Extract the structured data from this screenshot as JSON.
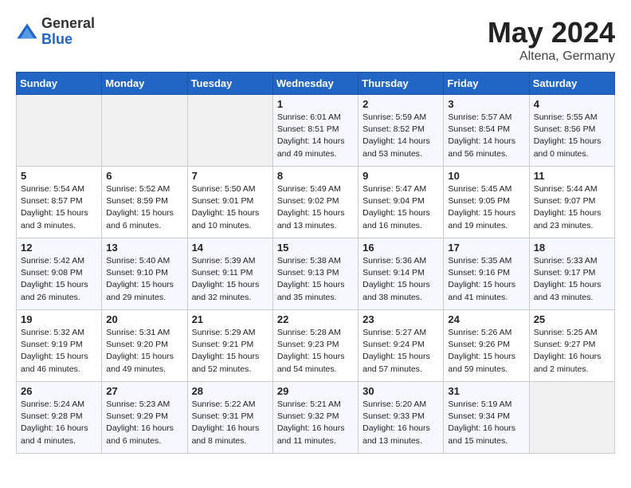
{
  "logo": {
    "general": "General",
    "blue": "Blue"
  },
  "title": {
    "month": "May 2024",
    "location": "Altena, Germany"
  },
  "weekdays": [
    "Sunday",
    "Monday",
    "Tuesday",
    "Wednesday",
    "Thursday",
    "Friday",
    "Saturday"
  ],
  "weeks": [
    [
      {
        "day": "",
        "content": ""
      },
      {
        "day": "",
        "content": ""
      },
      {
        "day": "",
        "content": ""
      },
      {
        "day": "1",
        "content": "Sunrise: 6:01 AM\nSunset: 8:51 PM\nDaylight: 14 hours\nand 49 minutes."
      },
      {
        "day": "2",
        "content": "Sunrise: 5:59 AM\nSunset: 8:52 PM\nDaylight: 14 hours\nand 53 minutes."
      },
      {
        "day": "3",
        "content": "Sunrise: 5:57 AM\nSunset: 8:54 PM\nDaylight: 14 hours\nand 56 minutes."
      },
      {
        "day": "4",
        "content": "Sunrise: 5:55 AM\nSunset: 8:56 PM\nDaylight: 15 hours\nand 0 minutes."
      }
    ],
    [
      {
        "day": "5",
        "content": "Sunrise: 5:54 AM\nSunset: 8:57 PM\nDaylight: 15 hours\nand 3 minutes."
      },
      {
        "day": "6",
        "content": "Sunrise: 5:52 AM\nSunset: 8:59 PM\nDaylight: 15 hours\nand 6 minutes."
      },
      {
        "day": "7",
        "content": "Sunrise: 5:50 AM\nSunset: 9:01 PM\nDaylight: 15 hours\nand 10 minutes."
      },
      {
        "day": "8",
        "content": "Sunrise: 5:49 AM\nSunset: 9:02 PM\nDaylight: 15 hours\nand 13 minutes."
      },
      {
        "day": "9",
        "content": "Sunrise: 5:47 AM\nSunset: 9:04 PM\nDaylight: 15 hours\nand 16 minutes."
      },
      {
        "day": "10",
        "content": "Sunrise: 5:45 AM\nSunset: 9:05 PM\nDaylight: 15 hours\nand 19 minutes."
      },
      {
        "day": "11",
        "content": "Sunrise: 5:44 AM\nSunset: 9:07 PM\nDaylight: 15 hours\nand 23 minutes."
      }
    ],
    [
      {
        "day": "12",
        "content": "Sunrise: 5:42 AM\nSunset: 9:08 PM\nDaylight: 15 hours\nand 26 minutes."
      },
      {
        "day": "13",
        "content": "Sunrise: 5:40 AM\nSunset: 9:10 PM\nDaylight: 15 hours\nand 29 minutes."
      },
      {
        "day": "14",
        "content": "Sunrise: 5:39 AM\nSunset: 9:11 PM\nDaylight: 15 hours\nand 32 minutes."
      },
      {
        "day": "15",
        "content": "Sunrise: 5:38 AM\nSunset: 9:13 PM\nDaylight: 15 hours\nand 35 minutes."
      },
      {
        "day": "16",
        "content": "Sunrise: 5:36 AM\nSunset: 9:14 PM\nDaylight: 15 hours\nand 38 minutes."
      },
      {
        "day": "17",
        "content": "Sunrise: 5:35 AM\nSunset: 9:16 PM\nDaylight: 15 hours\nand 41 minutes."
      },
      {
        "day": "18",
        "content": "Sunrise: 5:33 AM\nSunset: 9:17 PM\nDaylight: 15 hours\nand 43 minutes."
      }
    ],
    [
      {
        "day": "19",
        "content": "Sunrise: 5:32 AM\nSunset: 9:19 PM\nDaylight: 15 hours\nand 46 minutes."
      },
      {
        "day": "20",
        "content": "Sunrise: 5:31 AM\nSunset: 9:20 PM\nDaylight: 15 hours\nand 49 minutes."
      },
      {
        "day": "21",
        "content": "Sunrise: 5:29 AM\nSunset: 9:21 PM\nDaylight: 15 hours\nand 52 minutes."
      },
      {
        "day": "22",
        "content": "Sunrise: 5:28 AM\nSunset: 9:23 PM\nDaylight: 15 hours\nand 54 minutes."
      },
      {
        "day": "23",
        "content": "Sunrise: 5:27 AM\nSunset: 9:24 PM\nDaylight: 15 hours\nand 57 minutes."
      },
      {
        "day": "24",
        "content": "Sunrise: 5:26 AM\nSunset: 9:26 PM\nDaylight: 15 hours\nand 59 minutes."
      },
      {
        "day": "25",
        "content": "Sunrise: 5:25 AM\nSunset: 9:27 PM\nDaylight: 16 hours\nand 2 minutes."
      }
    ],
    [
      {
        "day": "26",
        "content": "Sunrise: 5:24 AM\nSunset: 9:28 PM\nDaylight: 16 hours\nand 4 minutes."
      },
      {
        "day": "27",
        "content": "Sunrise: 5:23 AM\nSunset: 9:29 PM\nDaylight: 16 hours\nand 6 minutes."
      },
      {
        "day": "28",
        "content": "Sunrise: 5:22 AM\nSunset: 9:31 PM\nDaylight: 16 hours\nand 8 minutes."
      },
      {
        "day": "29",
        "content": "Sunrise: 5:21 AM\nSunset: 9:32 PM\nDaylight: 16 hours\nand 11 minutes."
      },
      {
        "day": "30",
        "content": "Sunrise: 5:20 AM\nSunset: 9:33 PM\nDaylight: 16 hours\nand 13 minutes."
      },
      {
        "day": "31",
        "content": "Sunrise: 5:19 AM\nSunset: 9:34 PM\nDaylight: 16 hours\nand 15 minutes."
      },
      {
        "day": "",
        "content": ""
      }
    ]
  ]
}
